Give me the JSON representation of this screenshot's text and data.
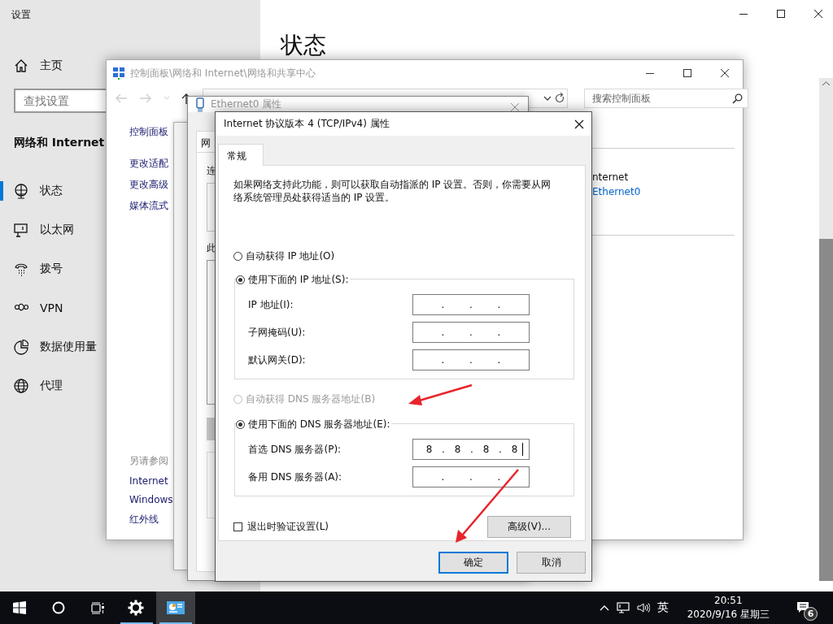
{
  "settings": {
    "title": "设置",
    "home": "主页",
    "search": {
      "placeholder": "查找设置"
    },
    "section": "网络和 Internet",
    "heading": "状态",
    "items": [
      {
        "kind": "status",
        "label": "状态",
        "selected": true
      },
      {
        "kind": "ethernet",
        "label": "以太网",
        "selected": false
      },
      {
        "kind": "dialup",
        "label": "拨号",
        "selected": false
      },
      {
        "kind": "vpn",
        "label": "VPN",
        "selected": false
      },
      {
        "kind": "data",
        "label": "数据使用量",
        "selected": false
      },
      {
        "kind": "proxy",
        "label": "代理",
        "selected": false
      }
    ]
  },
  "control_panel": {
    "title": "控制面板\\网络和 Internet\\网络和共享中心",
    "search": {
      "placeholder": "搜索控制面板"
    },
    "links": [
      "控制面板",
      "更改适配",
      "更改高级",
      "媒体流式"
    ],
    "see_also": {
      "heading": "另请参阅",
      "links": [
        "Internet",
        "Windows",
        "红外线"
      ]
    },
    "network": {
      "type_text": "nternet",
      "connection": "Ethernet0"
    }
  },
  "ethernet": {
    "title": "Ethernet0 属性",
    "tab": "网",
    "labels": [
      "连",
      "此"
    ]
  },
  "ipv4": {
    "title": "Internet 协议版本 4 (TCP/IPv4) 属性",
    "tabs": [
      {
        "label": "常规",
        "selected": true
      }
    ],
    "description": "如果网络支持此功能，则可以获取自动指派的 IP 设置。否则，你需要从网络系统管理员处获得适当的 IP 设置。",
    "separator": ".",
    "ip_mode": [
      {
        "label": "自动获得 IP 地址(O)",
        "selected": false,
        "disabled": false
      },
      {
        "label": "使用下面的 IP 地址(S):",
        "selected": true,
        "disabled": false
      }
    ],
    "ip_fields": [
      {
        "label": "IP 地址(I):"
      },
      {
        "label": "子网掩码(U):"
      },
      {
        "label": "默认网关(D):"
      }
    ],
    "dns_mode": [
      {
        "label": "自动获得 DNS 服务器地址(B)",
        "selected": false,
        "disabled": true
      },
      {
        "label": "使用下面的 DNS 服务器地址(E):",
        "selected": true,
        "disabled": false
      }
    ],
    "dns_fields": [
      {
        "label": "首选 DNS 服务器(P):",
        "octets": [
          "8",
          "8",
          "8",
          "8"
        ]
      },
      {
        "label": "备用 DNS 服务器(A):"
      }
    ],
    "validate": {
      "label": "退出时验证设置(L)",
      "checked": false
    },
    "buttons": {
      "advanced": "高级(V)...",
      "ok": "确定",
      "cancel": "取消"
    }
  },
  "taskbar": {
    "apps": [
      {
        "kind": "settings",
        "active": false
      },
      {
        "kind": "control_panel",
        "active": true
      }
    ],
    "tray": {
      "ime": "英",
      "time": "20:51",
      "date": "2020/9/16 星期三",
      "notifications": "6"
    }
  }
}
